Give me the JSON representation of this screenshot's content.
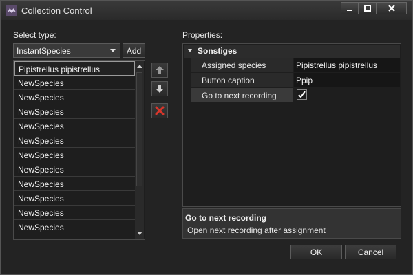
{
  "window": {
    "title": "Collection Control"
  },
  "left": {
    "select_type_label": "Select type:",
    "type_combo_value": "InstantSpecies",
    "add_label": "Add",
    "species_list": [
      "Pipistrellus pipistrellus",
      "NewSpecies",
      "NewSpecies",
      "NewSpecies",
      "NewSpecies",
      "NewSpecies",
      "NewSpecies",
      "NewSpecies",
      "NewSpecies",
      "NewSpecies",
      "NewSpecies",
      "NewSpecies",
      "NewSpecies"
    ]
  },
  "properties": {
    "label": "Properties:",
    "category": "Sonstiges",
    "rows": [
      {
        "name": "Assigned species",
        "value": "Pipistrellus pipistrellus"
      },
      {
        "name": "Button caption",
        "value": "Ppip"
      },
      {
        "name": "Go to next recording",
        "checked": true
      }
    ],
    "description_title": "Go to next recording",
    "description_text": "Open next recording after assignment"
  },
  "footer": {
    "ok_label": "OK",
    "cancel_label": "Cancel"
  },
  "icons": {
    "app": "bat-icon",
    "move_up": "arrow-up-icon",
    "move_down": "arrow-down-icon",
    "delete": "red-x-icon"
  },
  "colors": {
    "delete_red": "#d9362b",
    "background": "#232323"
  }
}
